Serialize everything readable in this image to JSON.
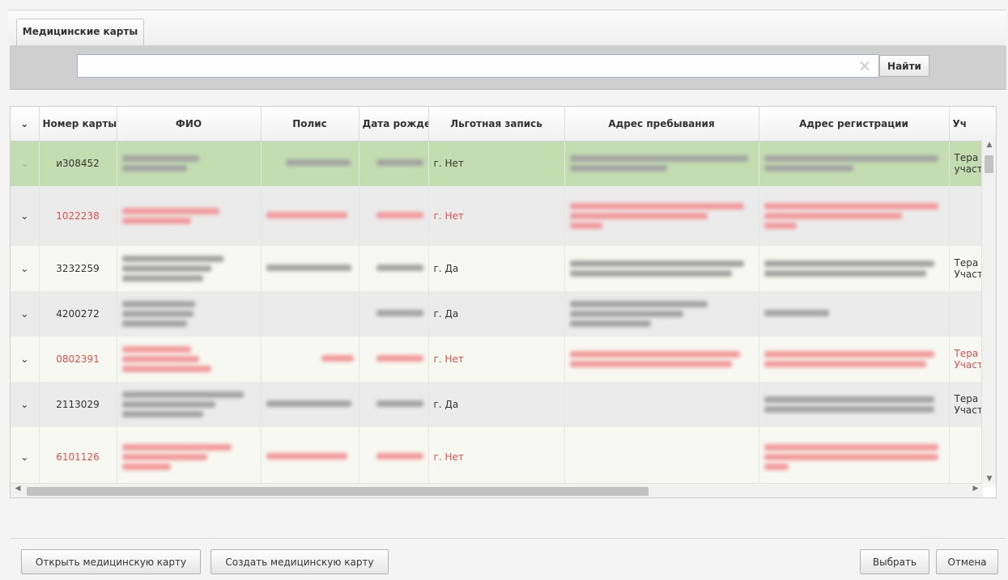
{
  "tab": {
    "label": "Медицинские карты"
  },
  "search": {
    "value": "",
    "placeholder": "",
    "clear_icon": "×",
    "button_label": "Найти"
  },
  "table": {
    "columns": [
      "",
      "Номер карты",
      "ФИО",
      "Полис",
      "Дата рождения",
      "Льготная запись",
      "Адрес пребывания",
      "Адрес регистрации",
      "Уч"
    ],
    "rows": [
      {
        "card_number": "и308452",
        "birth_suffix": "г.",
        "privilege": "Нет",
        "district": "Тера",
        "district2": "участ"
      },
      {
        "card_number": "1022238",
        "birth_suffix": "г.",
        "privilege": "Нет",
        "district": "",
        "district2": ""
      },
      {
        "card_number": "3232259",
        "birth_suffix": "г.",
        "privilege": "Да",
        "district": "Тера",
        "district2": "Участ"
      },
      {
        "card_number": "4200272",
        "birth_suffix": "г.",
        "privilege": "Да",
        "district": "",
        "district2": ""
      },
      {
        "card_number": "0802391",
        "birth_suffix": "г.",
        "privilege": "Нет",
        "district": "Тера",
        "district2": "Участ"
      },
      {
        "card_number": "2113029",
        "birth_suffix": "г.",
        "privilege": "Да",
        "district": "Тера",
        "district2": "Участ"
      },
      {
        "card_number": "6101126",
        "birth_suffix": "г.",
        "privilege": "Нет",
        "district": "",
        "district2": ""
      }
    ]
  },
  "footer": {
    "open_card": "Открыть медицинскую карту",
    "create_card": "Создать медицинскую карту",
    "select": "Выбрать",
    "cancel": "Отмена"
  },
  "colors": {
    "selected_row": "#c3ddb0",
    "red_text": "#e0504b",
    "search_border": "#9fb6d4"
  },
  "icons": {
    "row_expand": "chevron-down-icon",
    "clear": "clear-icon"
  }
}
